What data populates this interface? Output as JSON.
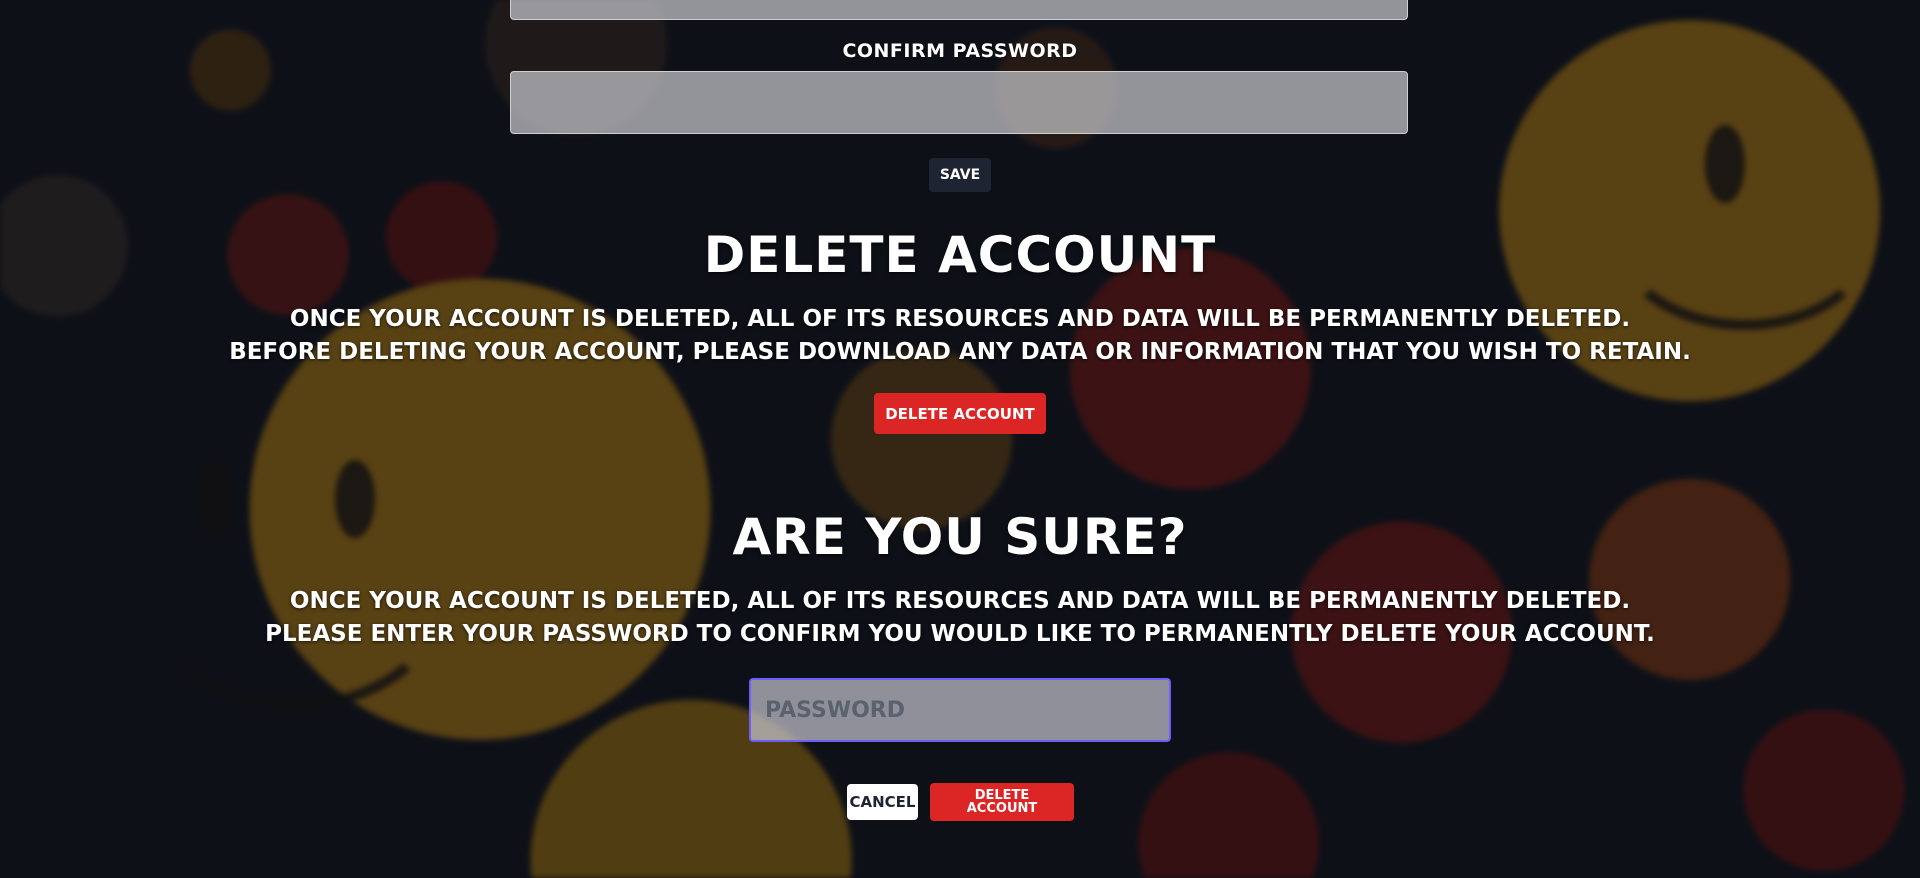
{
  "password_form": {
    "confirm_password_label": "CONFIRM PASSWORD",
    "confirm_password_value": "",
    "save_label": "SAVE"
  },
  "delete_section": {
    "title": "DELETE ACCOUNT",
    "line1": "ONCE YOUR ACCOUNT IS DELETED, ALL OF ITS RESOURCES AND DATA WILL BE PERMANENTLY DELETED.",
    "line2": "BEFORE DELETING YOUR ACCOUNT, PLEASE DOWNLOAD ANY DATA OR INFORMATION THAT YOU WISH TO RETAIN.",
    "button_label": "DELETE ACCOUNT"
  },
  "confirm_modal": {
    "title": "ARE YOU SURE?",
    "line1": "ONCE YOUR ACCOUNT IS DELETED, ALL OF ITS RESOURCES AND DATA WILL BE PERMANENTLY DELETED.",
    "line2": "PLEASE ENTER YOUR PASSWORD TO CONFIRM YOU WOULD LIKE TO PERMANENTLY DELETE YOUR ACCOUNT.",
    "password_placeholder": "PASSWORD",
    "password_value": "",
    "cancel_label": "CANCEL",
    "delete_label": "DELETE ACCOUNT"
  },
  "colors": {
    "danger": "#dc2626",
    "dark_button": "#1f2433",
    "focus_ring": "#6d5dfc"
  }
}
